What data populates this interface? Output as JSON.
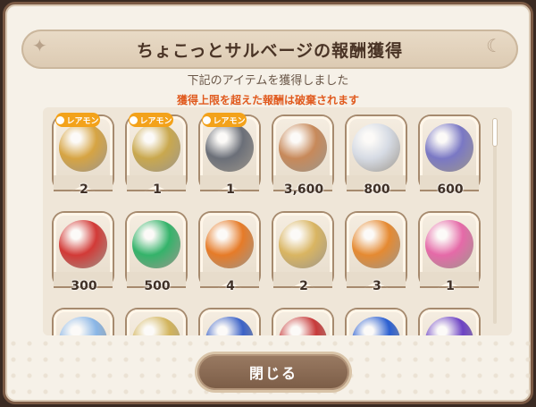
{
  "dialog": {
    "title": "ちょこっとサルベージの報酬獲得",
    "subtitle": "下記のアイテムを獲得しました",
    "warning": "獲得上限を超えた報酬は破棄されます",
    "close_label": "閉じる"
  },
  "badge_text": "レアモン",
  "items": [
    {
      "count": "2",
      "icon": "golden-wheel-icon",
      "badge": true,
      "color": "#d6a443"
    },
    {
      "count": "1",
      "icon": "ornate-lantern-icon",
      "badge": true,
      "color": "#c9a84e"
    },
    {
      "count": "1",
      "icon": "gold-ore-icon",
      "badge": true,
      "color": "#6b6f78"
    },
    {
      "count": "3,600",
      "icon": "copper-coin-icon",
      "badge": false,
      "color": "#c7895a"
    },
    {
      "count": "800",
      "icon": "silver-star-icon",
      "badge": false,
      "color": "#d6dbe4"
    },
    {
      "count": "600",
      "icon": "magic-branch-icon",
      "badge": false,
      "color": "#7a78c4"
    },
    {
      "count": "300",
      "icon": "red-fang-icon",
      "badge": false,
      "color": "#d23a37"
    },
    {
      "count": "500",
      "icon": "green-orb-icon",
      "badge": false,
      "color": "#34b36a"
    },
    {
      "count": "4",
      "icon": "sun-medal-icon",
      "badge": false,
      "color": "#e67b28"
    },
    {
      "count": "2",
      "icon": "pocket-watch-icon",
      "badge": false,
      "color": "#d9b562"
    },
    {
      "count": "3",
      "icon": "potion-bottle-icon",
      "badge": false,
      "color": "#e58a32"
    },
    {
      "count": "1",
      "icon": "pink-potion-icon",
      "badge": false,
      "color": "#e56aa8"
    },
    {
      "count": "",
      "icon": "blue-crystal-icon",
      "badge": false,
      "color": "#8ab6e6"
    },
    {
      "count": "",
      "icon": "golden-sword-icon",
      "badge": false,
      "color": "#d2b45c"
    },
    {
      "count": "",
      "icon": "blue-vial-icon",
      "badge": false,
      "color": "#3b62c7"
    },
    {
      "count": "",
      "icon": "red-vial-icon",
      "badge": false,
      "color": "#c73a3a"
    },
    {
      "count": "",
      "icon": "sapphire-vial-icon",
      "badge": false,
      "color": "#2b5fd1"
    },
    {
      "count": "",
      "icon": "violet-vial-icon",
      "badge": false,
      "color": "#6d43c4"
    }
  ]
}
